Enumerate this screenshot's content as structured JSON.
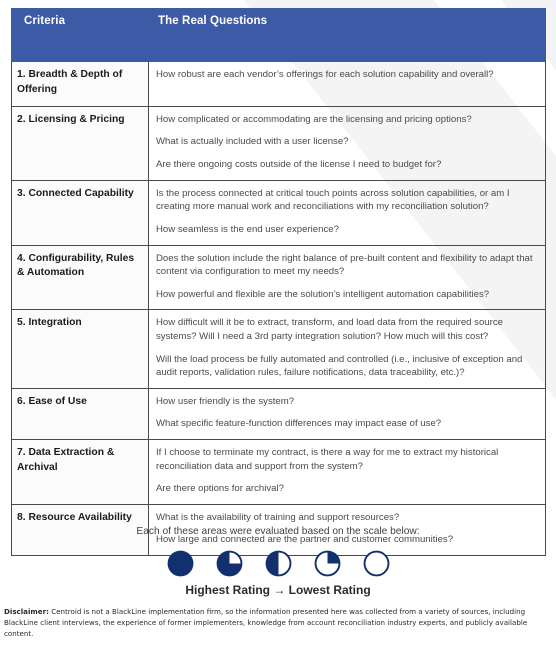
{
  "colors": {
    "header_blue": "#3c5aa6",
    "rating_navy": "#12306e",
    "border_gray": "#4a4a4a",
    "body_text": "#4b4b4b"
  },
  "table": {
    "headers": {
      "criteria": "Criteria",
      "questions": "The Real Questions"
    },
    "rows": [
      {
        "criteria": "1. Breadth & Depth of Offering",
        "questions": [
          "How robust are each vendor’s offerings for each solution capability and overall?"
        ]
      },
      {
        "criteria": "2. Licensing & Pricing",
        "questions": [
          "How complicated or accommodating are the licensing and pricing options?",
          "What is actually included with a user license?",
          "Are there ongoing costs outside of the license I need to budget for?"
        ]
      },
      {
        "criteria": "3. Connected Capability",
        "questions": [
          "Is the process connected at critical touch points across solution capabilities, or am I creating more manual work and reconciliations with my reconciliation solution?",
          "How seamless is the end user experience?"
        ]
      },
      {
        "criteria": "4. Configurability, Rules & Automation",
        "questions": [
          "Does the solution include the right balance of pre-built content and flexibility to adapt that content via configuration to meet my needs?",
          "How powerful and flexible are the solution’s intelligent automation capabilities?"
        ]
      },
      {
        "criteria": "5. Integration",
        "questions": [
          "How difficult will it be to extract, transform, and load data from the required source systems? Will I need a 3rd party integration solution? How much will this cost?",
          "Will the load process be fully automated and controlled (i.e., inclusive of exception and audit reports, validation rules, failure notifications, data traceability, etc.)?"
        ]
      },
      {
        "criteria": "6. Ease of Use",
        "questions": [
          "How user friendly is the system?",
          "What specific feature-function differences may impact ease of use?"
        ]
      },
      {
        "criteria": "7. Data Extraction & Archival",
        "questions": [
          "If I choose to terminate my contract, is there a way for me to extract my historical reconciliation data and support from the system?",
          "Are there options for archival?"
        ]
      },
      {
        "criteria": "8. Resource Availability",
        "questions": [
          "What is the availability of training and support resources?",
          "How large and connected are the partner and customer communities?"
        ]
      }
    ]
  },
  "scale": {
    "caption": "Each of these areas were evaluated based on the scale below:",
    "legend": "Highest Rating → Lowest Rating",
    "ratings": [
      {
        "name": "rating-full",
        "fill": 1.0,
        "label": "Full circle"
      },
      {
        "name": "rating-three-quarter",
        "fill": 0.75,
        "label": "Three quarters filled"
      },
      {
        "name": "rating-half",
        "fill": 0.5,
        "label": "Half filled"
      },
      {
        "name": "rating-quarter",
        "fill": 0.25,
        "label": "One quarter filled"
      },
      {
        "name": "rating-empty",
        "fill": 0.0,
        "label": "Empty circle"
      }
    ]
  },
  "disclaimer": {
    "label": "Disclaimer:",
    "text": " Centroid is not a BlackLine implementation firm, so the information presented here was collected from a variety of sources, including BlackLine client interviews, the experience of former implementers, knowledge from account reconciliation industry experts, and publicly available content."
  }
}
